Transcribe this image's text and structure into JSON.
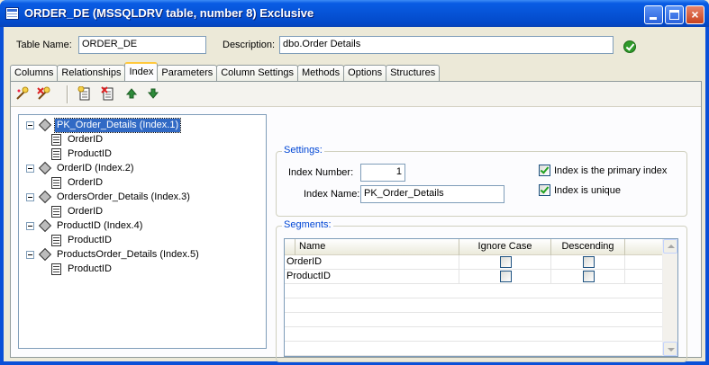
{
  "window": {
    "title": "ORDER_DE  (MSSQLDRV table, number 8)  Exclusive",
    "icon": "table-window-icon",
    "controls": {
      "minimize": "minimize-icon",
      "maximize": "maximize-icon",
      "close": "×"
    }
  },
  "header": {
    "table_name_label": "Table Name:",
    "table_name_value": "ORDER_DE",
    "description_label": "Description:",
    "description_value": "dbo.Order Details",
    "status_icon": "green-check-icon"
  },
  "tabs": [
    {
      "label": "Columns",
      "active": false
    },
    {
      "label": "Relationships",
      "active": false
    },
    {
      "label": "Index",
      "active": true
    },
    {
      "label": "Parameters",
      "active": false
    },
    {
      "label": "Column Settings",
      "active": false
    },
    {
      "label": "Methods",
      "active": false
    },
    {
      "label": "Options",
      "active": false
    },
    {
      "label": "Structures",
      "active": false
    }
  ],
  "toolbar": {
    "buttons": [
      "new-index-icon",
      "delete-index-icon",
      "add-segment-icon",
      "remove-segment-icon",
      "move-up-icon",
      "move-down-icon"
    ]
  },
  "tree": [
    {
      "label": "PK_Order_Details (Index.1)",
      "selected": true,
      "children": [
        "OrderID",
        "ProductID"
      ]
    },
    {
      "label": "OrderID (Index.2)",
      "selected": false,
      "children": [
        "OrderID"
      ]
    },
    {
      "label": "OrdersOrder_Details (Index.3)",
      "selected": false,
      "children": [
        "OrderID"
      ]
    },
    {
      "label": "ProductID (Index.4)",
      "selected": false,
      "children": [
        "ProductID"
      ]
    },
    {
      "label": "ProductsOrder_Details (Index.5)",
      "selected": false,
      "children": [
        "ProductID"
      ]
    }
  ],
  "settings": {
    "title": "Settings:",
    "index_number_label": "Index Number:",
    "index_number_value": "1",
    "index_name_label": "Index Name:",
    "index_name_value": "PK_Order_Details",
    "primary_label": "Index is the primary index",
    "primary_checked": true,
    "unique_label": "Index is unique",
    "unique_checked": true
  },
  "segments": {
    "title": "Segments:",
    "columns": [
      "Name",
      "Ignore Case",
      "Descending"
    ],
    "rows": [
      {
        "name": "OrderID",
        "ignore_case": false,
        "descending": false
      },
      {
        "name": "ProductID",
        "ignore_case": false,
        "descending": false
      }
    ]
  }
}
